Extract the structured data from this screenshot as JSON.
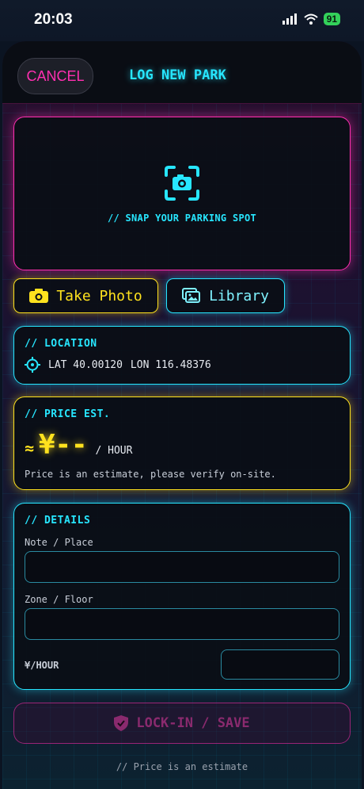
{
  "status": {
    "time": "20:03",
    "battery": "91"
  },
  "header": {
    "cancel": "CANCEL",
    "title": "LOG NEW PARK"
  },
  "photo": {
    "hint": "// SNAP YOUR PARKING SPOT",
    "take_photo": "Take Photo",
    "library": "Library"
  },
  "location": {
    "section": "// LOCATION",
    "lat": "LAT 40.00120",
    "lon": "LON 116.48376"
  },
  "price": {
    "section": "// PRICE EST.",
    "approx": "≈",
    "value": "¥--",
    "unit": "/ HOUR",
    "note": "Price is an estimate, please verify on-site."
  },
  "details": {
    "section": "// DETAILS",
    "note_label": "Note / Place",
    "zone_label": "Zone / Floor",
    "rate_label": "¥/HOUR",
    "note_value": "",
    "zone_value": "",
    "rate_value": ""
  },
  "actions": {
    "save": "LOCK-IN / SAVE"
  },
  "footer": {
    "note": "// Price is an estimate"
  },
  "colors": {
    "neon_pink": "#ff2fb0",
    "neon_cyan": "#27e6ff",
    "neon_yellow": "#ffe21e"
  }
}
